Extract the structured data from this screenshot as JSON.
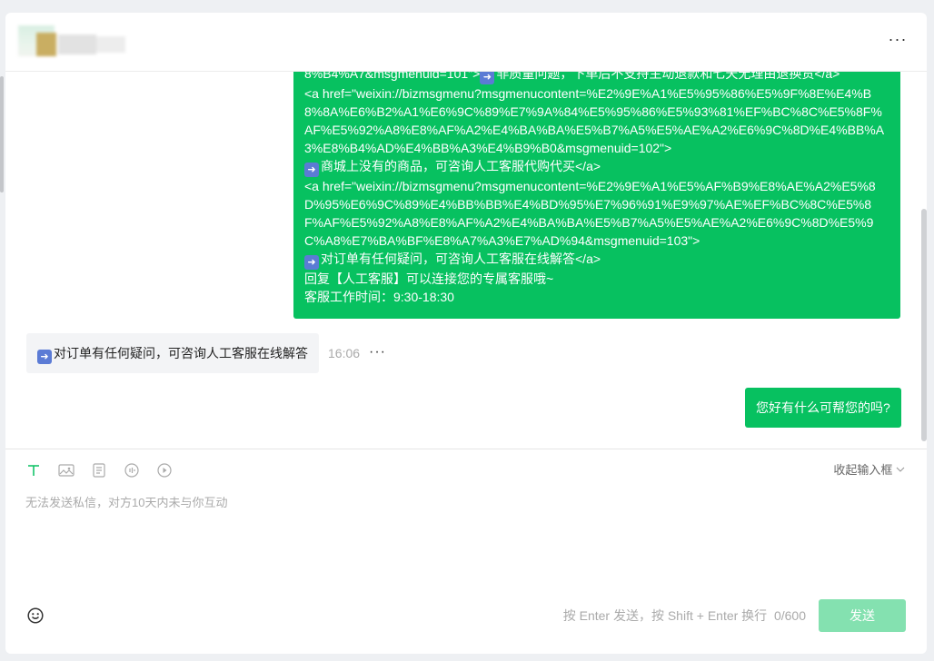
{
  "header": {
    "contact_name": "(blurred)",
    "more_icon": "more-horizontal-icon",
    "more_label": "···"
  },
  "conversation": {
    "long_message": {
      "lines": [
        "8%B4%A7&msgmenuid=101\">",
        "非质量问题，下单后不支持主动退款和七天无理由退换货</a>",
        "<a href=\"weixin://bizmsgmenu?msgmenucontent=%E2%9E%A1%E5%95%86%E5%9F%8E%E4%B8%8A%E6%B2%A1%E6%9C%89%E7%9A%84%E5%95%86%E5%93%81%EF%BC%8C%E5%8F%AF%E5%92%A8%E8%AF%A2%E4%BA%BA%E5%B7%A5%E5%AE%A2%E6%9C%8D%E4%BB%A3%E8%B4%AD%E4%BB%A3%E4%B9%B0&msgmenuid=102\">",
        "商城上没有的商品，可咨询人工客服代购代买</a>",
        "<a href=\"weixin://bizmsgmenu?msgmenucontent=%E2%9E%A1%E5%AF%B9%E8%AE%A2%E5%8D%95%E6%9C%89%E4%BB%BB%E4%BD%95%E7%96%91%E9%97%AE%EF%BC%8C%E5%8F%AF%E5%92%A8%E8%AF%A2%E4%BA%BA%E5%B7%A5%E5%AE%A2%E6%9C%8D%E5%9C%A8%E7%BA%BF%E8%A7%A3%E7%AD%94&msgmenuid=103\">",
        "对订单有任何疑问，可咨询人工客服在线解答</a>",
        "回复【人工客服】可以连接您的专属客服哦~",
        "客服工作时间：9:30-18:30"
      ],
      "arrow_emoji": "right-arrow-emoji"
    },
    "received_message": {
      "text": "对订单有任何疑问，可咨询人工客服在线解答",
      "time": "16:06",
      "more_label": "···"
    },
    "sent_message": {
      "text": "您好有什么可帮您的吗?"
    }
  },
  "composer": {
    "tools": [
      "text-icon",
      "image-icon",
      "document-icon",
      "audio-icon",
      "video-icon"
    ],
    "collapse_label": "收起输入框",
    "placeholder": "无法发送私信，对方10天内未与你互动",
    "hint": "按 Enter 发送，按 Shift + Enter 换行",
    "char_count": "0/600",
    "send_label": "发送",
    "colors": {
      "accent": "#07c160",
      "send_disabled": "#84e1b0",
      "tool_active": "#07c160"
    }
  }
}
